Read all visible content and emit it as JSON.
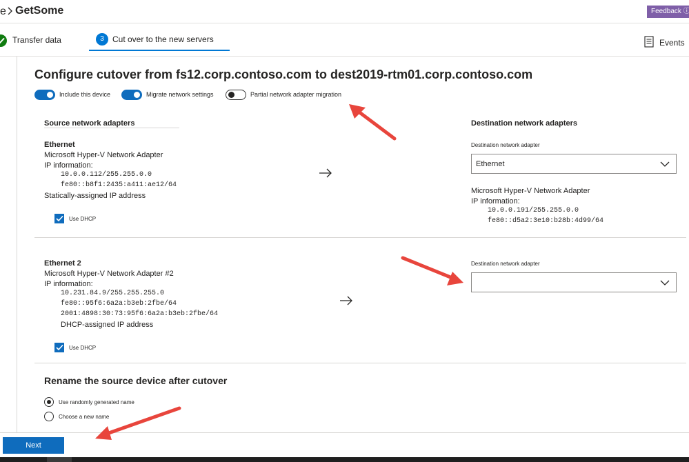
{
  "header": {
    "breadcrumb_prev": "e",
    "app_title": "GetSome",
    "feedback_label": "Feedback"
  },
  "tabs": [
    {
      "label": "Transfer data",
      "status": "complete"
    },
    {
      "label": "Cut over to the new servers",
      "step": "3",
      "active": true
    }
  ],
  "events_label": "Events",
  "main": {
    "title": "Configure cutover from fs12.corp.contoso.com to dest2019-rtm01.corp.contoso.com",
    "toggles": [
      {
        "label": "Include this device",
        "on": true
      },
      {
        "label": "Migrate network settings",
        "on": true
      },
      {
        "label": "Partial network adapter migration",
        "on": false
      }
    ],
    "source_heading": "Source network adapters",
    "destination_heading": "Destination network adapters",
    "adapters": [
      {
        "name": "Ethernet",
        "description": "Microsoft Hyper-V Network Adapter",
        "ip_info_label": "IP information:",
        "ips": [
          "10.0.0.112/255.255.0.0",
          "fe80::b8f1:2435:a411:ae12/64"
        ],
        "assignment": "Statically-assigned IP address",
        "use_dhcp_label": "Use DHCP",
        "use_dhcp": true,
        "dest_label": "Destination network adapter",
        "dest_value": "Ethernet",
        "dest_description": "Microsoft Hyper-V Network Adapter",
        "dest_ip_info_label": "IP information:",
        "dest_ips": [
          "10.0.0.191/255.255.0.0",
          "fe80::d5a2:3e10:b28b:4d99/64"
        ]
      },
      {
        "name": "Ethernet 2",
        "description": "Microsoft Hyper-V Network Adapter #2",
        "ip_info_label": "IP information:",
        "ips": [
          "10.231.84.9/255.255.255.0",
          "fe80::95f6:6a2a:b3eb:2fbe/64",
          "2001:4898:30:73:95f6:6a2a:b3eb:2fbe/64"
        ],
        "assignment": "DHCP-assigned IP address",
        "use_dhcp_label": "Use DHCP",
        "use_dhcp": true,
        "dest_label": "Destination network adapter",
        "dest_value": ""
      }
    ],
    "rename": {
      "title": "Rename the source device after cutover",
      "options": [
        {
          "label": "Use randomly generated name",
          "selected": true
        },
        {
          "label": "Choose a new name",
          "selected": false
        }
      ]
    }
  },
  "footer": {
    "next_label": "Next"
  },
  "icons": {
    "complete": "checkmark-icon",
    "events": "document-list-icon",
    "arrow": "arrow-right-icon",
    "dropdown": "chevron-down-icon",
    "annotation": "red-arrow-annotation"
  },
  "colors": {
    "accent": "#0f6cbd",
    "feedback": "#7f5fa8",
    "complete": "#107c10",
    "annotation": "#e8453c"
  }
}
